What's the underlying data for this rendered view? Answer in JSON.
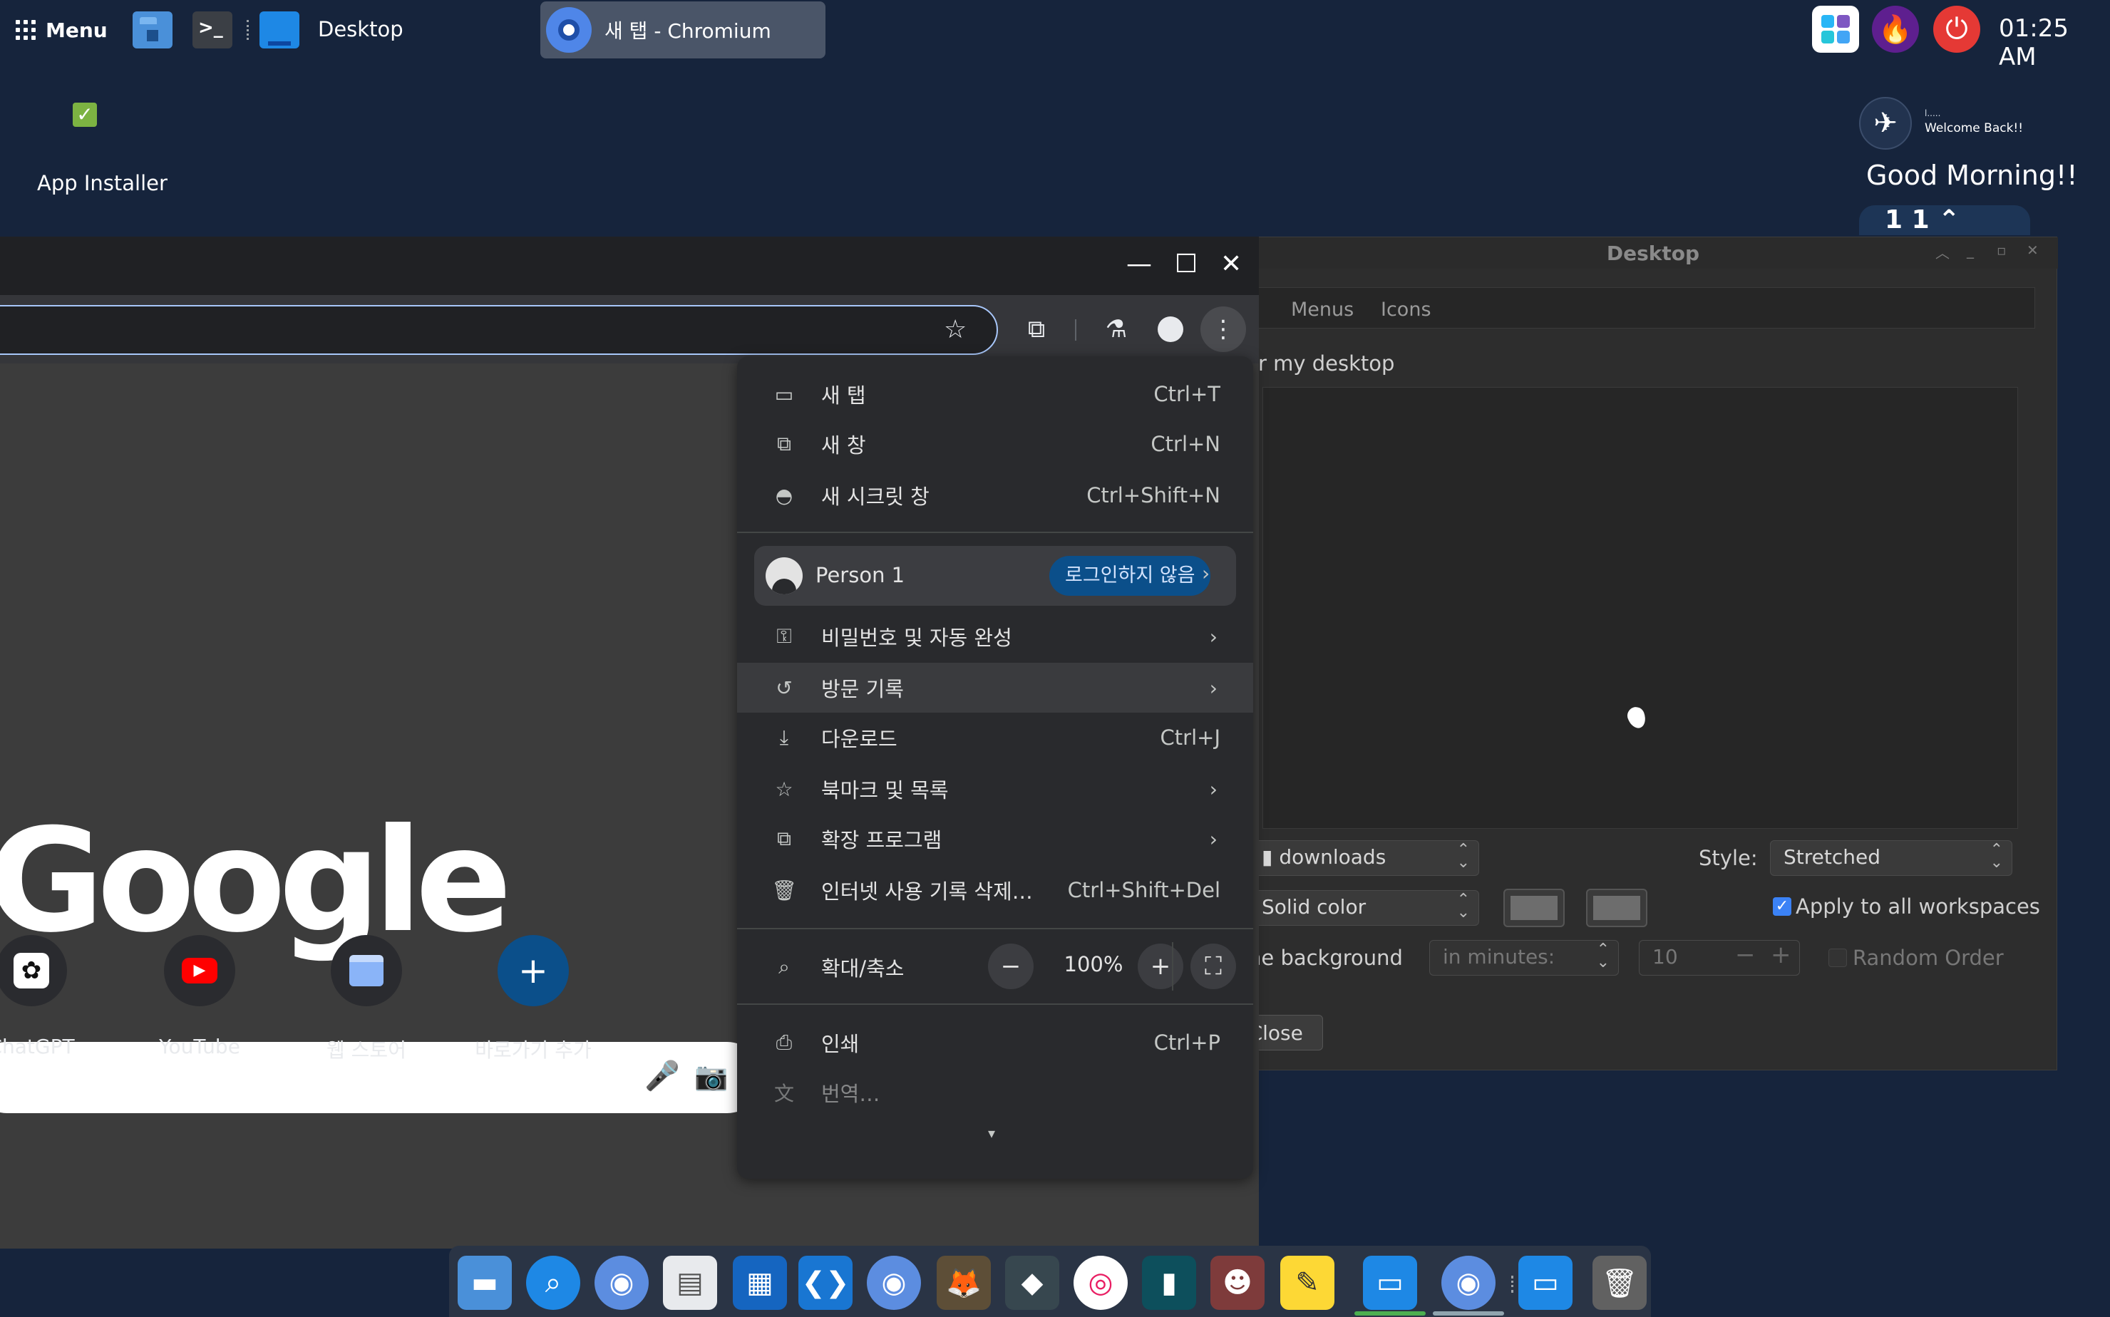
{
  "taskbar": {
    "menu_label": "Menu",
    "desktop_label": "Desktop",
    "chromium_task": "새 탭 - Chromium",
    "clock": "01:25 AM"
  },
  "desktop": {
    "icon_label": "App Installer",
    "widget": {
      "tiny_text": "l.....",
      "welcome": "Welcome Back!!",
      "greeting": "Good Morning!!",
      "pill_text": "1 1 ⌃"
    }
  },
  "desktop_window": {
    "title": "Desktop",
    "tabs": [
      "Menus",
      "Icons"
    ],
    "heading": "r my desktop",
    "folder_combo": "downloads",
    "style_label": "Style:",
    "style_value": "Stretched",
    "color_combo": "Solid color",
    "apply_all": "Apply to all workspaces",
    "change_bg": "he background",
    "interval_combo": "in minutes:",
    "interval_value": "10",
    "random_order": "Random Order",
    "close_label": "Close"
  },
  "chromium": {
    "google_logo": "Google",
    "shortcuts": [
      {
        "label": "ChatGPT"
      },
      {
        "label": "YouTube"
      },
      {
        "label": "웹 스토어"
      },
      {
        "label": "바로가기 추가"
      }
    ]
  },
  "chrome_menu": {
    "items": [
      {
        "label": "새 탭",
        "shortcut": "Ctrl+T"
      },
      {
        "label": "새 창",
        "shortcut": "Ctrl+N"
      },
      {
        "label": "새 시크릿 창",
        "shortcut": "Ctrl+Shift+N"
      }
    ],
    "person": {
      "name": "Person 1",
      "badge": "로그인하지 않음"
    },
    "items2": [
      {
        "label": "비밀번호 및 자동 완성",
        "shortcut": ""
      },
      {
        "label": "방문 기록",
        "shortcut": ""
      },
      {
        "label": "다운로드",
        "shortcut": "Ctrl+J"
      },
      {
        "label": "북마크 및 목록",
        "shortcut": ""
      },
      {
        "label": "확장 프로그램",
        "shortcut": ""
      },
      {
        "label": "인터넷 사용 기록 삭제…",
        "shortcut": "Ctrl+Shift+Del"
      }
    ],
    "zoom": {
      "label": "확대/축소",
      "value": "100%",
      "minus": "−",
      "plus": "+"
    },
    "items3": [
      {
        "label": "인쇄",
        "shortcut": "Ctrl+P"
      },
      {
        "label": "번역…",
        "shortcut": ""
      }
    ],
    "more": "▾"
  },
  "colors": {
    "desktop_bg": "#16243c",
    "accent_blue": "#a8c7fa",
    "badge_blue": "#0b4f8a",
    "youtube_red": "#ff0000"
  }
}
